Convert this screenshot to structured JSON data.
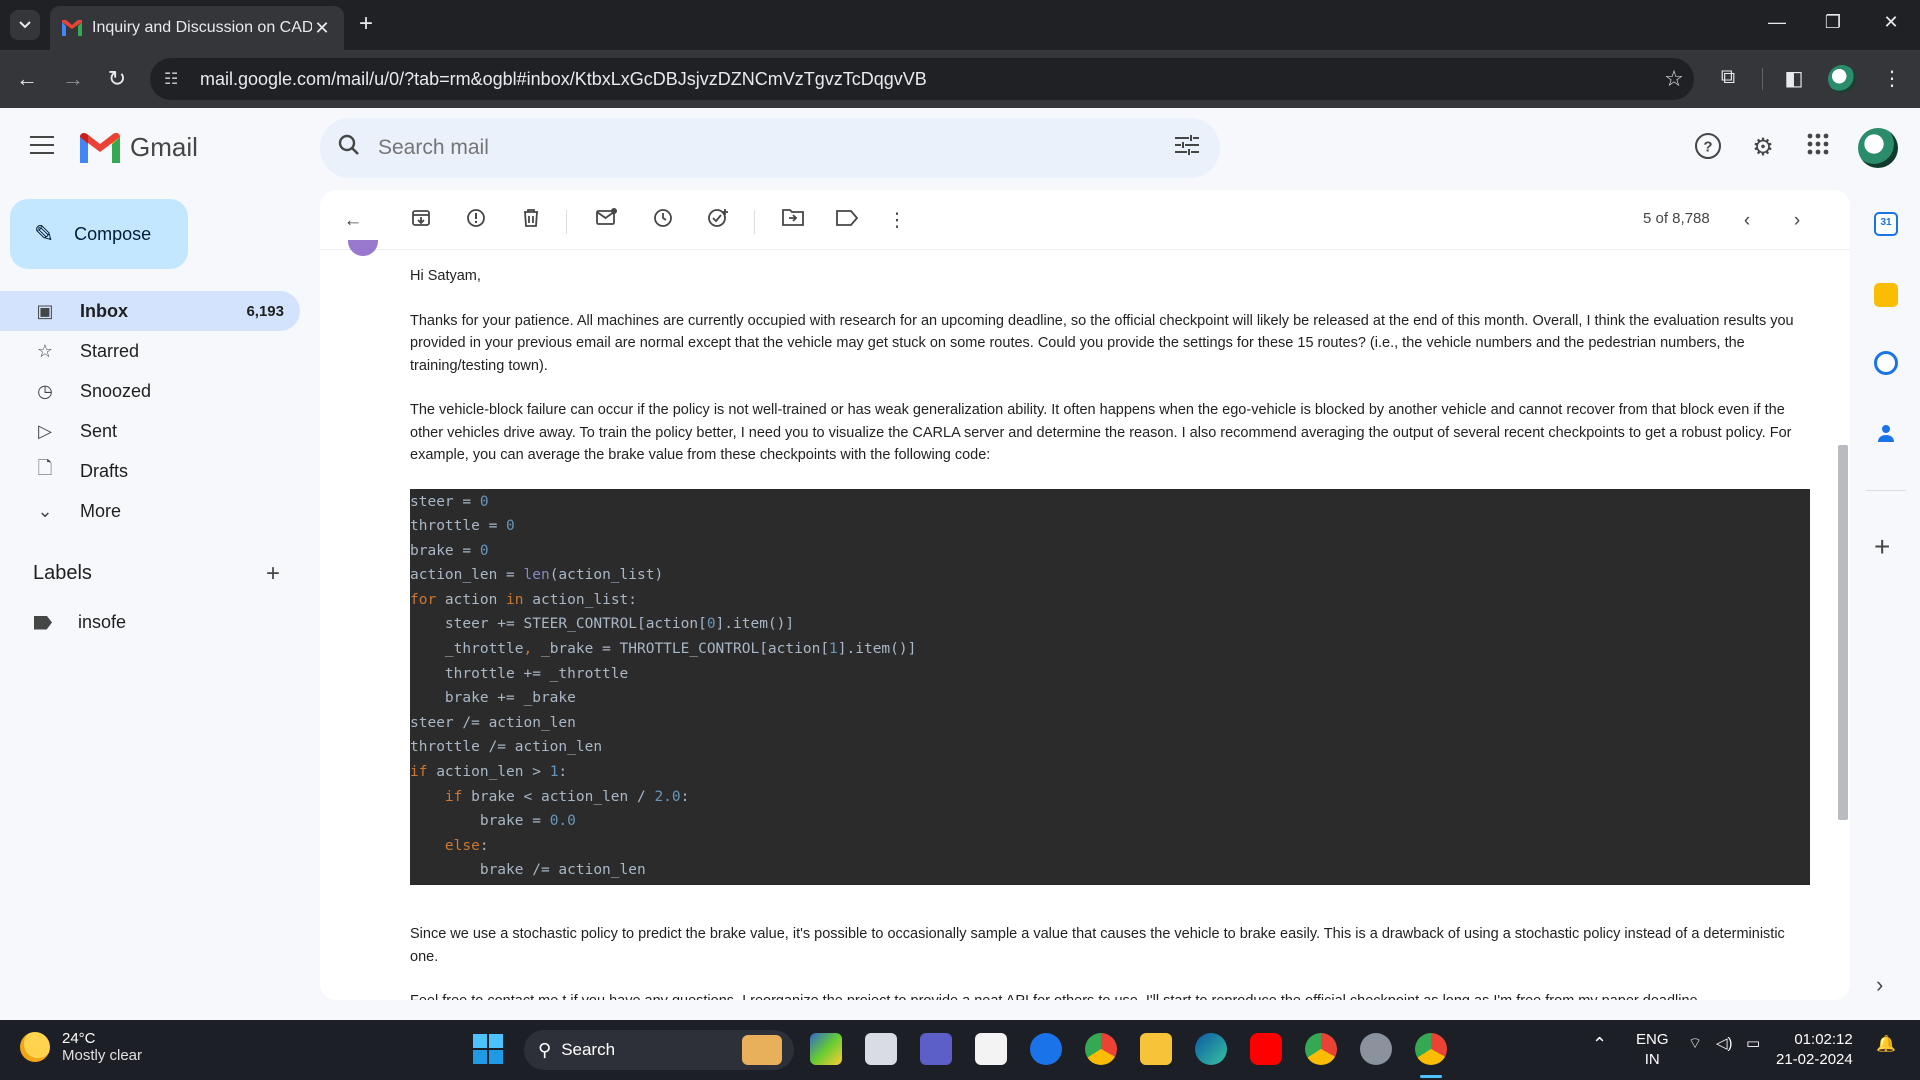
{
  "browser": {
    "tab_title": "Inquiry and Discussion on CADI",
    "url": "mail.google.com/mail/u/0/?tab=rm&ogbl#inbox/KtbxLxGcDBJsjvzDZNCmVzTgvzTcDqgvVB"
  },
  "gmail": {
    "brand": "Gmail",
    "search_placeholder": "Search mail",
    "compose_label": "Compose",
    "nav": [
      {
        "label": "Inbox",
        "count": "6,193"
      },
      {
        "label": "Starred",
        "count": ""
      },
      {
        "label": "Snoozed",
        "count": ""
      },
      {
        "label": "Sent",
        "count": ""
      },
      {
        "label": "Drafts",
        "count": ""
      },
      {
        "label": "More",
        "count": ""
      }
    ],
    "labels_heading": "Labels",
    "labels": [
      "insofe"
    ],
    "pager": "5 of 8,788"
  },
  "email": {
    "greeting": "Hi Satyam,",
    "para1": "Thanks for your patience. All machines are currently occupied with research for an upcoming deadline, so the official checkpoint will likely be released at the end of this month. Overall, I think the evaluation results you provided in your previous email are normal except that the vehicle may get stuck on some routes. Could you provide the settings for these 15 routes? (i.e., the vehicle numbers and the pedestrian numbers, the training/testing town).",
    "para2": "The vehicle-block failure can occur if the policy is not well-trained or has weak generalization ability. It often happens when the ego-vehicle is blocked by another vehicle and cannot recover from that block even if the other vehicles drive away. To train the policy better, I need you to visualize the CARLA server and determine the reason. I  also recommend averaging the output of several recent checkpoints to get a robust policy. For example, you can average the brake value from these checkpoints with the following code:",
    "code": [
      "steer = 0",
      "throttle = 0",
      "brake = 0",
      "action_len = len(action_list)",
      "for action in action_list:",
      "    steer += STEER_CONTROL[action[0].item()]",
      "    _throttle, _brake = THROTTLE_CONTROL[action[1].item()]",
      "    throttle += _throttle",
      "    brake += _brake",
      "steer /= action_len",
      "throttle /= action_len",
      "if action_len > 1:",
      "    if brake < action_len / 2.0:",
      "        brake = 0.0",
      "    else:",
      "        brake /= action_len"
    ],
    "para3": "Since we use a stochastic policy to predict the brake value, it's possible to occasionally sample a value that causes the vehicle to brake easily. This is a drawback of using a stochastic policy instead of a deterministic one.",
    "para4": "Feel free to contact me t if you have any questions. I reorganize the project to provide a neat API for others to use. I'll start to reproduce the official checkpoint as long as I'm free from my paper deadline."
  },
  "taskbar": {
    "temp": "24°C",
    "weather": "Mostly clear",
    "search_label": "Search",
    "lang1": "ENG",
    "lang2": "IN",
    "time": "01:02:12",
    "date": "21-02-2024"
  },
  "colors": {
    "accent": "#c2e7ff",
    "active_nav": "#d3e3fd",
    "code_bg": "#2b2b2b"
  }
}
